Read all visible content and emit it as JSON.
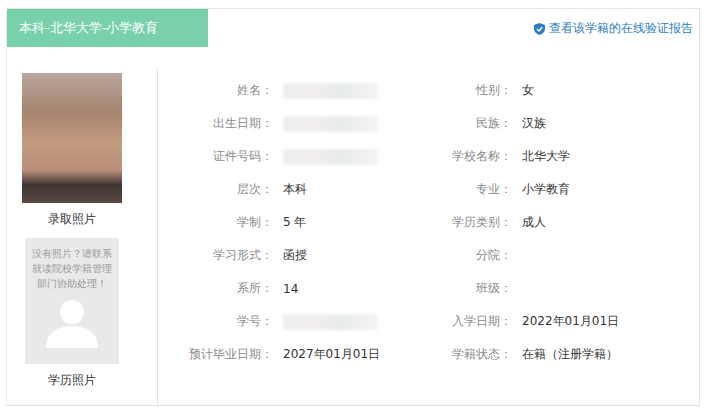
{
  "header": {
    "title": "本科-北华大学-小学教育",
    "verify_link": "查看该学籍的在线验证报告"
  },
  "photos": [
    {
      "label": "录取照片",
      "kind": "photo"
    },
    {
      "label": "学历照片",
      "kind": "placeholder",
      "note": "没有照片？请联系就读院校学籍管理部门协助处理！"
    }
  ],
  "rows": [
    [
      {
        "label": "姓名：",
        "kind": "blurred"
      },
      {
        "label": "性别：",
        "kind": "text",
        "value": "女"
      }
    ],
    [
      {
        "label": "出生日期：",
        "kind": "blurred"
      },
      {
        "label": "民族：",
        "kind": "text",
        "value": "汉族"
      }
    ],
    [
      {
        "label": "证件号码：",
        "kind": "blurred"
      },
      {
        "label": "学校名称：",
        "kind": "text",
        "value": "北华大学"
      }
    ],
    [
      {
        "label": "层次：",
        "kind": "text",
        "value": "本科"
      },
      {
        "label": "专业：",
        "kind": "text",
        "value": "小学教育"
      }
    ],
    [
      {
        "label": "学制：",
        "kind": "text",
        "value": "5 年"
      },
      {
        "label": "学历类别：",
        "kind": "text",
        "value": "成人"
      }
    ],
    [
      {
        "label": "学习形式：",
        "kind": "text",
        "value": "函授"
      },
      {
        "label": "分院：",
        "kind": "empty"
      }
    ],
    [
      {
        "label": "系所：",
        "kind": "text",
        "value": "14"
      },
      {
        "label": "班级：",
        "kind": "empty"
      }
    ],
    [
      {
        "label": "学号：",
        "kind": "blurred"
      },
      {
        "label": "入学日期：",
        "kind": "text",
        "value": "2022年01月01日"
      }
    ],
    [
      {
        "label": "预计毕业日期：",
        "kind": "text",
        "value": "2027年01月01日"
      },
      {
        "label": "学籍状态：",
        "kind": "text",
        "value": "在籍（注册学籍）"
      }
    ]
  ]
}
